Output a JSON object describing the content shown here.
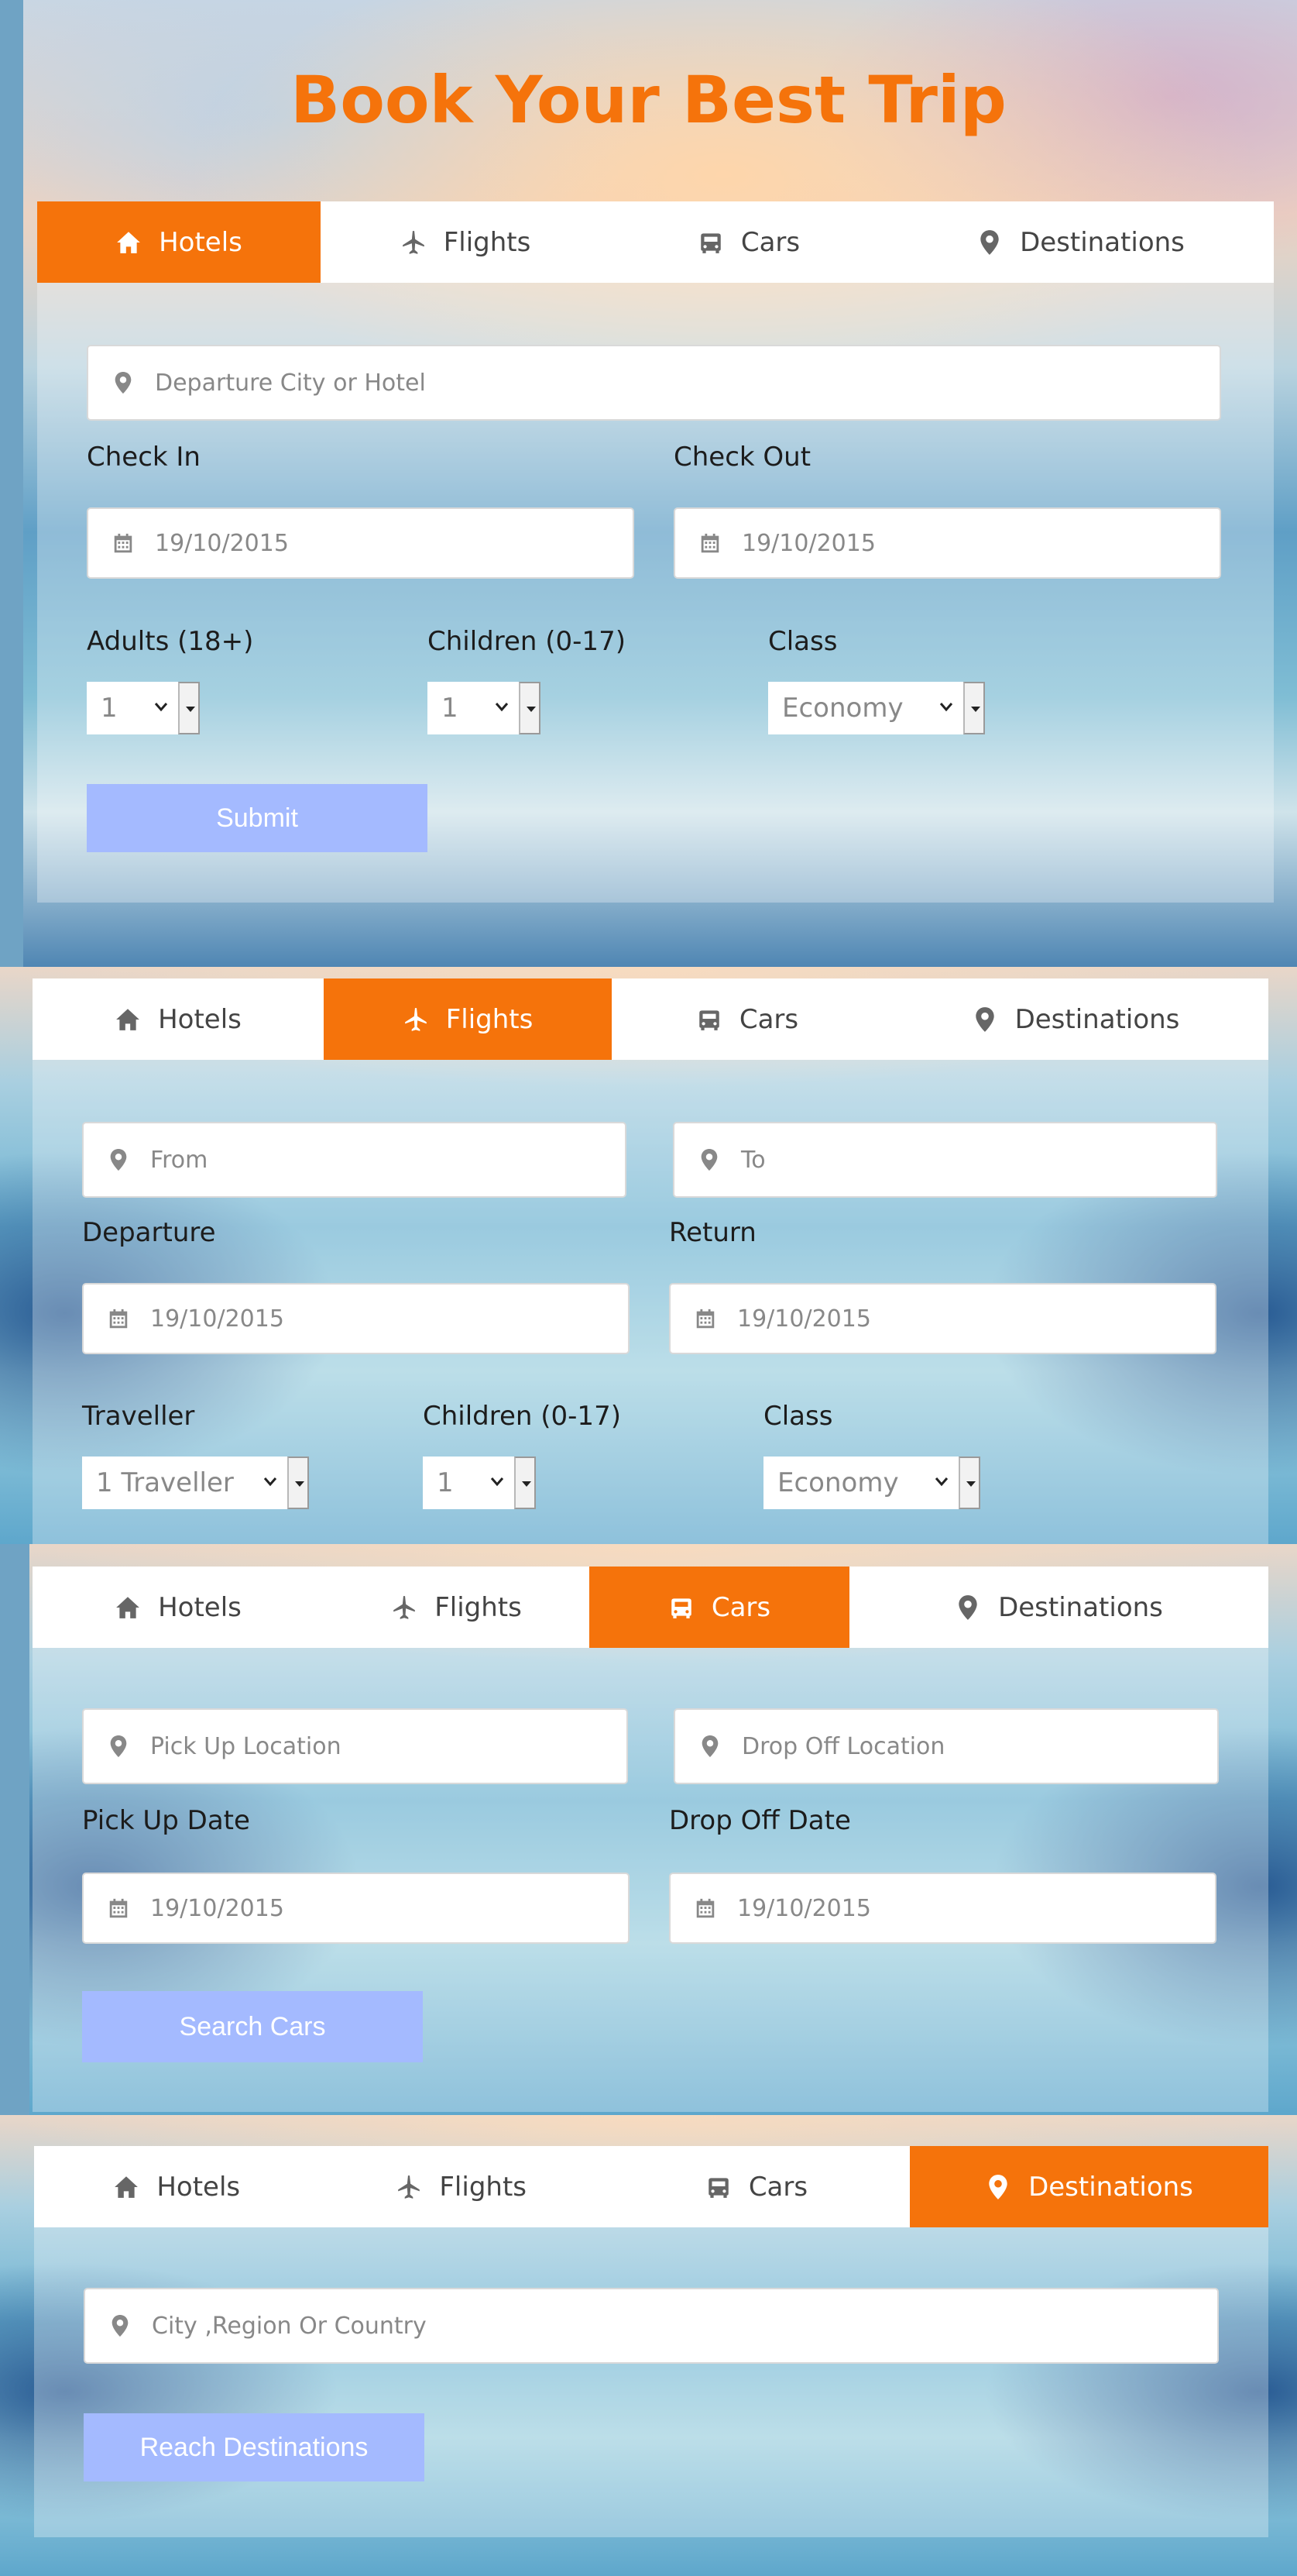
{
  "page_title": "Book Your Best Trip",
  "colors": {
    "accent": "#f5730b",
    "button": "#a4baff",
    "tab_bg": "#ffffff"
  },
  "tab_labels": {
    "hotels": "Hotels",
    "flights": "Flights",
    "cars": "Cars",
    "destinations": "Destinations"
  },
  "hotels_panel": {
    "active_tab": "Hotels",
    "location_placeholder": "Departure City or Hotel",
    "check_in_label": "Check In",
    "check_in_value": "19/10/2015",
    "check_out_label": "Check Out",
    "check_out_value": "19/10/2015",
    "adults_label": "Adults (18+)",
    "adults_value": "1",
    "children_label": "Children (0-17)",
    "children_value": "1",
    "class_label": "Class",
    "class_value": "Economy",
    "submit_label": "Submit"
  },
  "flights_panel": {
    "active_tab": "Flights",
    "from_placeholder": "From",
    "to_placeholder": "To",
    "departure_label": "Departure",
    "departure_value": "19/10/2015",
    "return_label": "Return",
    "return_value": "19/10/2015",
    "traveller_label": "Traveller",
    "traveller_value": "1 Traveller",
    "children_label": "Children (0-17)",
    "children_value": "1",
    "class_label": "Class",
    "class_value": "Economy"
  },
  "cars_panel": {
    "active_tab": "Cars",
    "pickup_location_placeholder": "Pick Up Location",
    "dropoff_location_placeholder": "Drop Off Location",
    "pickup_date_label": "Pick Up Date",
    "pickup_date_value": "19/10/2015",
    "dropoff_date_label": "Drop Off Date",
    "dropoff_date_value": "19/10/2015",
    "search_label": "Search Cars"
  },
  "destinations_panel": {
    "active_tab": "Destinations",
    "location_placeholder": "City ,Region Or Country",
    "reach_label": "Reach Destinations"
  },
  "icons": {
    "hotels": "home-icon",
    "flights": "plane-icon",
    "cars": "car-icon",
    "destinations": "map-marker-icon",
    "field_location": "map-marker-icon",
    "field_date": "calendar-icon"
  }
}
